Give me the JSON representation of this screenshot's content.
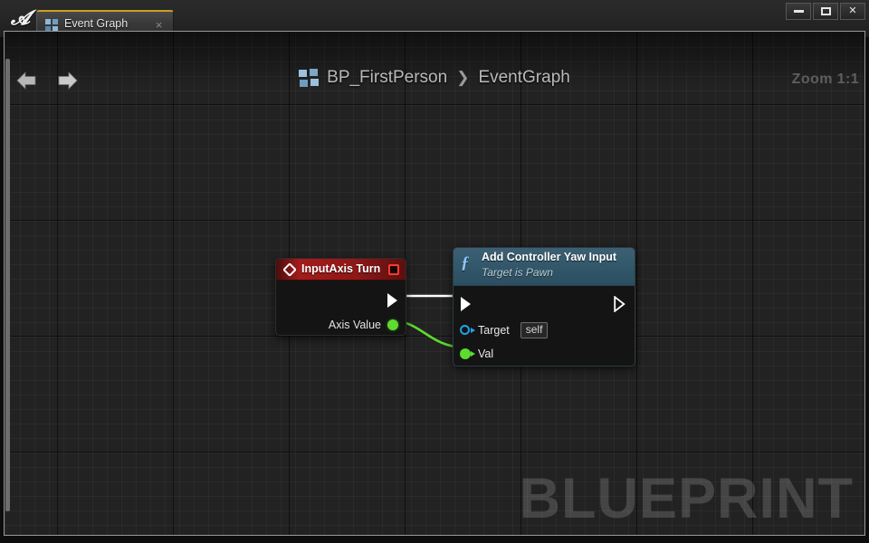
{
  "window": {
    "logo": "unreal-engine-logo",
    "tab": {
      "label": "Event Graph",
      "icon": "blueprint-grid-icon",
      "close": "×"
    },
    "controls": {
      "minimize": "minimize-icon",
      "maximize": "maximize-icon",
      "close": "✕"
    }
  },
  "graph": {
    "nav": {
      "back": "back-arrow-icon",
      "forward": "forward-arrow-icon"
    },
    "breadcrumb": {
      "icon": "blueprint-grid-icon",
      "blueprint": "BP_FirstPerson",
      "separator": "❯",
      "graph": "EventGraph"
    },
    "zoom_label": "Zoom 1:1",
    "watermark": "BLUEPRINT",
    "background_color": "#222222"
  },
  "nodes": [
    {
      "id": "input-axis-turn",
      "type": "event",
      "title": "InputAxis Turn",
      "header_color": "#a41b1b",
      "icon": "event-diamond-icon",
      "badge": "red-square-icon",
      "pins": {
        "exec_out": "exec-out-pin",
        "axis_value_label": "Axis Value",
        "axis_value_color": "#5ddb2e"
      }
    },
    {
      "id": "add-controller-yaw-input",
      "type": "function",
      "title": "Add Controller Yaw Input",
      "subtitle": "Target is Pawn",
      "header_color": "#34596d",
      "icon": "function-f-icon",
      "pins": {
        "exec_in": "exec-in-pin",
        "exec_out": "exec-out-pin",
        "target_label": "Target",
        "target_value": "self",
        "target_color": "#1ea3e8",
        "val_label": "Val",
        "val_color": "#5ddb2e"
      }
    }
  ],
  "wires": [
    {
      "name": "exec-wire",
      "from": "input-axis-turn.exec_out",
      "to": "add-controller-yaw-input.exec_in",
      "color": "#ffffff"
    },
    {
      "name": "data-wire",
      "from": "input-axis-turn.axis_value",
      "to": "add-controller-yaw-input.val",
      "color": "#5ddb2e"
    }
  ]
}
